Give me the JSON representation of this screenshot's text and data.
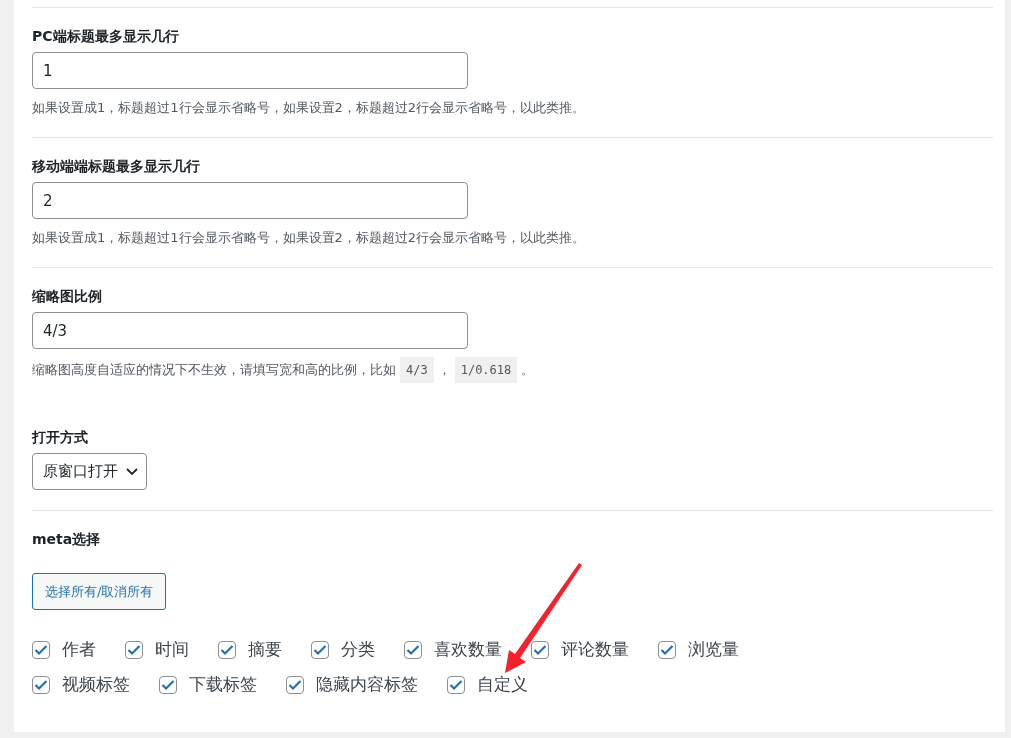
{
  "sections": [
    {
      "kind": "text",
      "divider_above": true,
      "label": "PC端标题最多显示几行",
      "value": "1",
      "help": [
        {
          "kind": "text",
          "text": "如果设置成1，标题超过1行会显示省略号，如果设置2，标题超过2行会显示省略号，以此类推。"
        }
      ]
    },
    {
      "kind": "text",
      "divider_above": true,
      "label": "移动端端标题最多显示几行",
      "value": "2",
      "help": [
        {
          "kind": "text",
          "text": "如果设置成1，标题超过1行会显示省略号，如果设置2，标题超过2行会显示省略号，以此类推。"
        }
      ]
    },
    {
      "kind": "text",
      "divider_above": true,
      "label": "缩略图比例",
      "value": "4/3",
      "help": [
        {
          "kind": "text",
          "text": "缩略图高度自适应的情况下不生效，请填写宽和高的比例，比如"
        },
        {
          "kind": "code",
          "text": "4/3"
        },
        {
          "kind": "text",
          "text": "，"
        },
        {
          "kind": "code",
          "text": "1/0.618"
        },
        {
          "kind": "text",
          "text": "。"
        }
      ]
    },
    {
      "kind": "select",
      "divider_above": false,
      "label": "打开方式",
      "value": "原窗口打开"
    },
    {
      "kind": "checkboxes",
      "divider_above": true,
      "label": "meta选择",
      "button": "选择所有/取消所有",
      "options": [
        {
          "label": "作者",
          "checked": true
        },
        {
          "label": "时间",
          "checked": true
        },
        {
          "label": "摘要",
          "checked": true
        },
        {
          "label": "分类",
          "checked": true
        },
        {
          "label": "喜欢数量",
          "checked": true
        },
        {
          "label": "评论数量",
          "checked": true
        },
        {
          "label": "浏览量",
          "checked": true
        },
        {
          "label": "视频标签",
          "checked": true
        },
        {
          "label": "下载标签",
          "checked": true
        },
        {
          "label": "隐藏内容标签",
          "checked": true
        },
        {
          "label": "自定义",
          "checked": true
        }
      ]
    }
  ],
  "annotation": {
    "kind": "arrow",
    "color": "#f5222d"
  }
}
